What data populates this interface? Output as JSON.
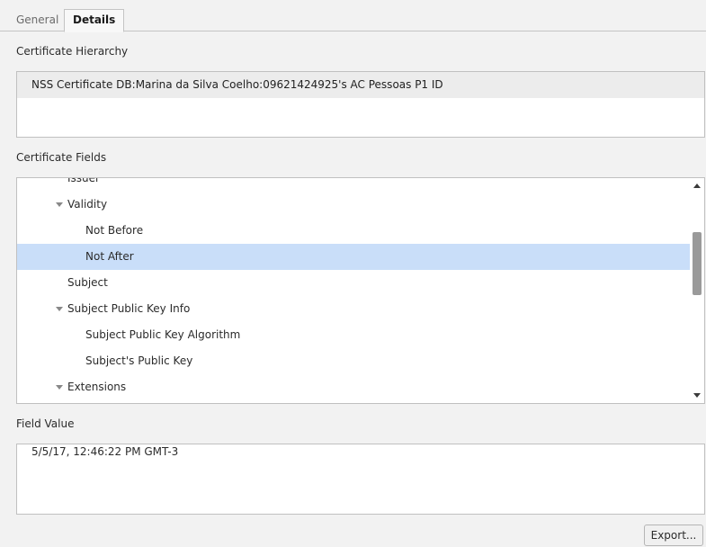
{
  "tabs": [
    {
      "label": "General",
      "active": false
    },
    {
      "label": "Details",
      "active": true
    }
  ],
  "hierarchy": {
    "heading": "Certificate Hierarchy",
    "items": [
      "NSS Certificate DB:Marina da Silva Coelho:09621424925's AC Pessoas P1 ID"
    ]
  },
  "fields": {
    "heading": "Certificate Fields",
    "rows": [
      {
        "label": "Issuer",
        "level": 1,
        "expanded": null,
        "selected": false
      },
      {
        "label": "Validity",
        "level": 1,
        "expanded": true,
        "selected": false
      },
      {
        "label": "Not Before",
        "level": 2,
        "expanded": null,
        "selected": false
      },
      {
        "label": "Not After",
        "level": 2,
        "expanded": null,
        "selected": true
      },
      {
        "label": "Subject",
        "level": 1,
        "expanded": null,
        "selected": false
      },
      {
        "label": "Subject Public Key Info",
        "level": 1,
        "expanded": true,
        "selected": false
      },
      {
        "label": "Subject Public Key Algorithm",
        "level": 2,
        "expanded": null,
        "selected": false
      },
      {
        "label": "Subject's Public Key",
        "level": 2,
        "expanded": null,
        "selected": false
      },
      {
        "label": "Extensions",
        "level": 1,
        "expanded": true,
        "selected": false
      }
    ]
  },
  "field_value": {
    "heading": "Field Value",
    "text": "5/5/17, 12:46:22 PM GMT-3"
  },
  "export_label": "Export...",
  "colors": {
    "selected_row": "#c9def9",
    "hierarchy_row": "#ececec",
    "background": "#f2f2f2"
  }
}
